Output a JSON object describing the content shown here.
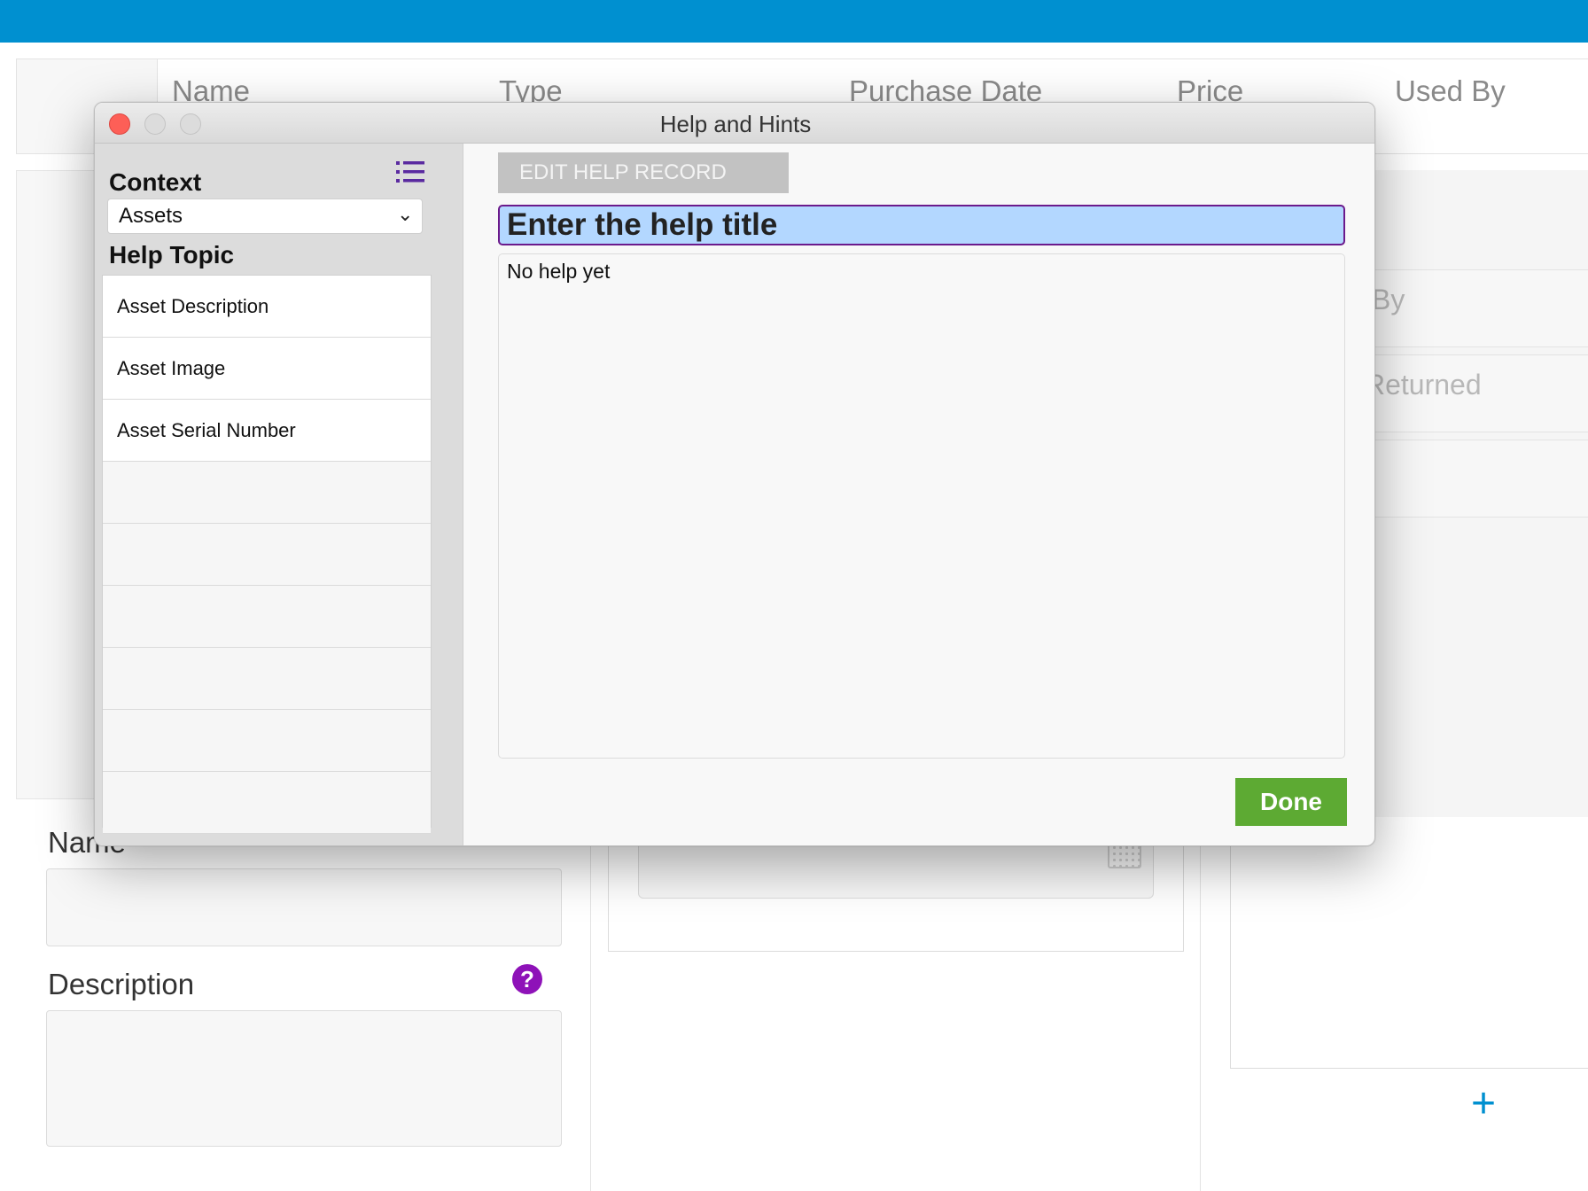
{
  "app": {
    "columns": [
      "Name",
      "Type",
      "Purchase Date",
      "Price",
      "Used By"
    ],
    "ghost_fields": [
      "By",
      "Returned"
    ],
    "form": {
      "name_label": "Name",
      "description_label": "Description",
      "help_icon": "question-circle-icon",
      "help_glyph": "?",
      "add_glyph": "+"
    },
    "colors": {
      "topbar": "#0090d0",
      "help_icon": "#8e12b8",
      "done": "#5daa33"
    }
  },
  "dialog": {
    "title": "Help and Hints",
    "sidebar": {
      "context_label": "Context",
      "context_value": "Assets",
      "list_icon": "list-icon",
      "topic_label": "Help Topic",
      "topics": [
        "Asset Description",
        "Asset Image",
        "Asset Serial Number",
        "",
        "",
        "",
        "",
        "",
        ""
      ]
    },
    "edit_button": "EDIT HELP RECORD",
    "title_field": "Enter the help title",
    "body_text": "No help yet",
    "done_button": "Done"
  }
}
